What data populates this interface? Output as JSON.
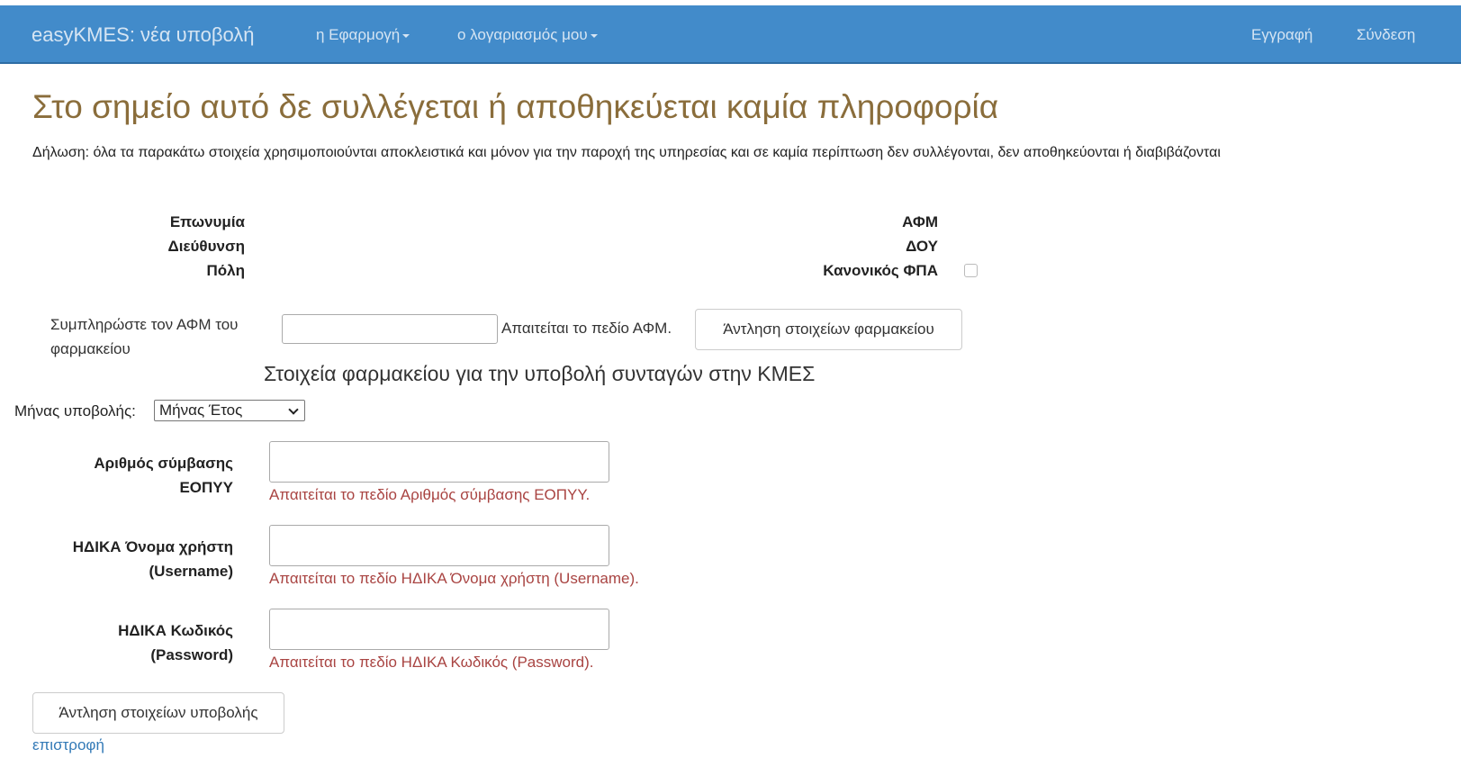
{
  "nav": {
    "brand": "easyKMES: νέα υποβολή",
    "app_menu": "η Εφαρμογή",
    "account_menu": "ο λογαριασμός μου",
    "register": "Εγγραφή",
    "login": "Σύνδεση"
  },
  "page": {
    "title": "Στο σημείο αυτό δε συλλέγεται ή αποθηκεύεται καμία πληροφορία",
    "declaration": "Δήλωση: όλα τα παρακάτω στοιχεία χρησιμοποιούνται αποκλειστικά και μόνον για την παροχή της υπηρεσίας και σε καμία περίπτωση δεν συλλέγονται, δεν αποθηκεύονται ή διαβιβάζονται"
  },
  "pharmacy_info": {
    "name_label": "Επωνυμία",
    "address_label": "Διεύθυνση",
    "city_label": "Πόλη",
    "afm_label": "ΑΦΜ",
    "doy_label": "ΔΟΥ",
    "vat_label": "Κανονικός ΦΠΑ",
    "vat_checked": false
  },
  "afm_form": {
    "label": "Συμπληρώστε τον ΑΦΜ του φαρμακείου",
    "value": "",
    "error": "Απαιτείται το πεδίο ΑΦΜ.",
    "fetch_button": "Άντληση στοιχείων φαρμακείου"
  },
  "submission": {
    "heading": "Στοιχεία φαρμακείου για την υποβολή συνταγών στην ΚΜΕΣ",
    "month_label": "Μήνας υποβολής:",
    "month_selected": "Μήνας Έτος",
    "contract_label": "Αριθμός σύμβασης ΕΟΠΥΥ",
    "contract_error": "Απαιτείται το πεδίο Αριθμός σύμβασης ΕΟΠΥΥ.",
    "username_label": "ΗΔΙΚΑ Όνομα χρήστη (Username)",
    "username_error": "Απαιτείται το πεδίο ΗΔΙΚΑ Όνομα χρήστη (Username).",
    "password_label": "ΗΔΙΚΑ Κωδικός (Password)",
    "password_error": "Απαιτείται το πεδίο ΗΔΙΚΑ Κωδικός (Password).",
    "fetch_button": "Άντληση στοιχείων υποβολής",
    "back_link": "επιστροφή"
  },
  "colors": {
    "navbar": "#428bca",
    "title": "#8a6d3b",
    "error": "#a94442",
    "link": "#337ab7"
  }
}
